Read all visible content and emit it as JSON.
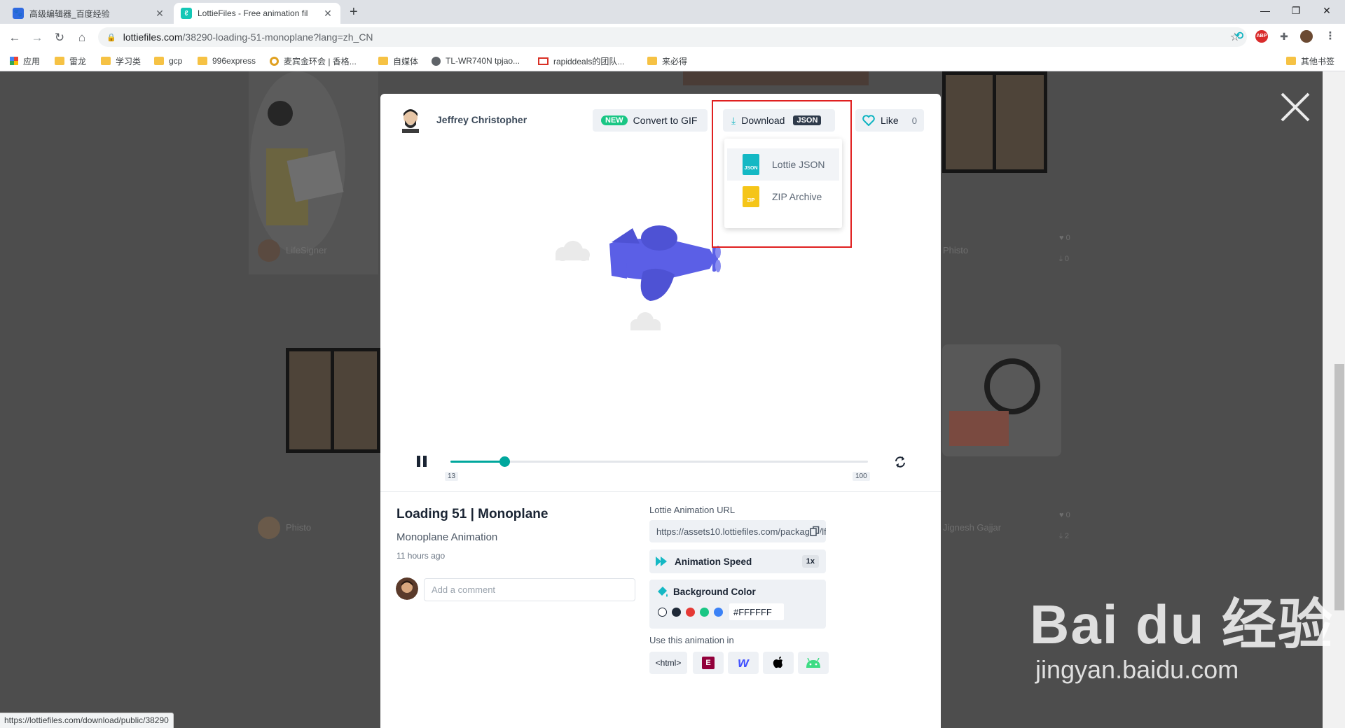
{
  "browser": {
    "tabs": [
      {
        "title": "高级编辑器_百度经验",
        "active": false
      },
      {
        "title": "LottieFiles - Free animation fil",
        "active": true
      }
    ],
    "new_tab": "+",
    "window_controls": {
      "minimize": "—",
      "restore": "❐",
      "close": "✕"
    },
    "url_host": "lottiefiles.com",
    "url_path": "/38290-loading-51-monoplane?lang=zh_CN",
    "extensions": [
      "refresh-ext-icon",
      "adblock-icon",
      "puzzle-icon",
      "profile-avatar"
    ],
    "adblock_label": "ABP",
    "bookmarks": [
      {
        "label": "应用",
        "icon": "apps-grid-icon"
      },
      {
        "label": "雷龙",
        "icon": "folder-icon"
      },
      {
        "label": "学习类",
        "icon": "folder-icon"
      },
      {
        "label": "gcp",
        "icon": "folder-icon"
      },
      {
        "label": "996express",
        "icon": "folder-icon"
      },
      {
        "label": "麦宾金环会 | 香格...",
        "icon": "site-icon"
      },
      {
        "label": "自媒体",
        "icon": "folder-icon"
      },
      {
        "label": "TL-WR740N tpjao...",
        "icon": "globe-icon"
      },
      {
        "label": "rapiddeals的团队...",
        "icon": "gmail-icon"
      },
      {
        "label": "来必得",
        "icon": "folder-icon"
      }
    ],
    "other_bookmarks": "其他书签",
    "status_url": "https://lottiefiles.com/download/public/38290"
  },
  "background": {
    "users": [
      "LifeSigner",
      "Phisto",
      "Phisto",
      "Jignesh Gajjar"
    ],
    "counts": [
      "0",
      "0",
      "0",
      "2"
    ]
  },
  "modal": {
    "author": "Jeffrey Christopher",
    "convert_badge": "NEW",
    "convert_label": "Convert to GIF",
    "download_label": "Download",
    "download_format": "JSON",
    "like_label": "Like",
    "like_count": "0",
    "download_menu": [
      {
        "label": "Lottie JSON",
        "icon_text": "JSON",
        "color": "#14b8c4"
      },
      {
        "label": "ZIP Archive",
        "icon_text": "ZIP",
        "color": "#f5c518"
      }
    ],
    "player": {
      "current_frame": "13",
      "total_frames": "100",
      "progress": 0.13
    },
    "title": "Loading 51 | Monoplane",
    "description": "Monoplane Animation",
    "time_ago": "11 hours ago",
    "comment_placeholder": "Add a comment",
    "url_label": "Lottie Animation URL",
    "url_value": "https://assets10.lottiefiles.com/packages/lf20_",
    "speed_label": "Animation Speed",
    "speed_value": "1x",
    "bg_label": "Background Color",
    "bg_hex": "#FFFFFF",
    "swatches": [
      "#ffffff",
      "#1f2937",
      "#e53935",
      "#19c684",
      "#3b82f6"
    ],
    "use_in_label": "Use this animation in",
    "use_in": [
      {
        "label": "<html>",
        "icon": "html-icon"
      },
      {
        "label": "",
        "icon": "elementor-icon"
      },
      {
        "label": "w",
        "icon": "webflow-icon"
      },
      {
        "label": "",
        "icon": "apple-icon"
      },
      {
        "label": "",
        "icon": "android-icon"
      }
    ]
  },
  "watermark": {
    "brand": "Bai du 经验",
    "site": "jingyan.baidu.com"
  },
  "colors": {
    "accent": "#00a79d",
    "plane": "#5b5fe6",
    "overlay": "#4d4d4d",
    "highlight": "#e02020"
  }
}
